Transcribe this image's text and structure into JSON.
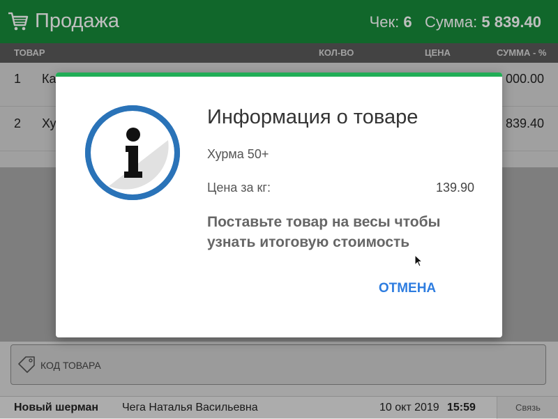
{
  "header": {
    "title": "Продажа",
    "check_label": "Чек:",
    "check_number": "6",
    "sum_label": "Сумма:",
    "sum_value": "5 839.40"
  },
  "table": {
    "columns": [
      "ТОВАР",
      "КОЛ-ВО",
      "ЦЕНА",
      "СУММА - %"
    ],
    "rows": [
      {
        "num": "1",
        "name": "Ка",
        "sum": "000.00"
      },
      {
        "num": "2",
        "name": "Ху",
        "sum": "839.40"
      }
    ]
  },
  "code_input": {
    "placeholder": "КОД ТОВАРА"
  },
  "status_bar": {
    "store": "Новый шерман",
    "cashier": "Чега Наталья Васильевна",
    "date": "10 окт 2019",
    "time": "15:59",
    "link": "Связь"
  },
  "dialog": {
    "title": "Информация о товаре",
    "product": "Хурма 50+",
    "price_label": "Цена за кг:",
    "price_value": "139.90",
    "message": "Поставьте товар на весы чтобы узнать итоговую стоимость",
    "cancel_label": "ОТМЕНА"
  },
  "colors": {
    "header": "#178a3a",
    "accent_bar": "#21ad56",
    "button": "#2e7de0",
    "icon_ring": "#2a73b8"
  },
  "icons": [
    "cart-icon",
    "tag-icon",
    "info-icon",
    "cursor-icon"
  ]
}
